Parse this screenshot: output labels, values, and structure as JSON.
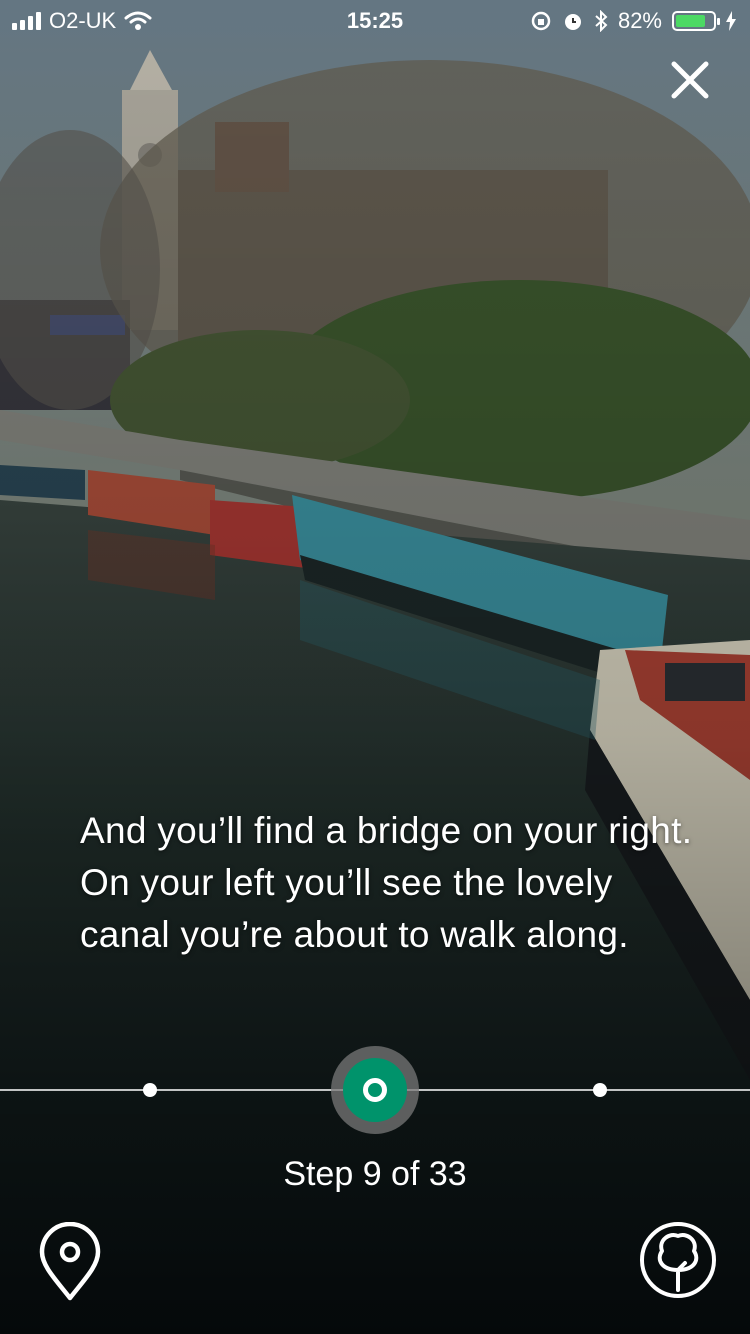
{
  "status_bar": {
    "carrier": "O2-UK",
    "time": "15:25",
    "battery_percent": "82%",
    "battery_level": 0.82,
    "icons": [
      "signal-icon",
      "wifi-icon",
      "rotation-lock-icon",
      "alarm-icon",
      "bluetooth-icon",
      "battery-icon",
      "charging-icon"
    ]
  },
  "walk": {
    "instruction": "And you’ll find a bridge on your right. On your left you’ll see the lovely canal you’re about to walk along.",
    "step_label": "Step 9 of 33",
    "current_step": 9,
    "total_steps": 33
  },
  "controls": {
    "close_icon": "close-icon",
    "map_icon": "map-pin-icon",
    "tree_icon": "tree-icon"
  },
  "colors": {
    "accent": "#00936b",
    "battery": "#4cd964",
    "text": "#ffffff"
  }
}
